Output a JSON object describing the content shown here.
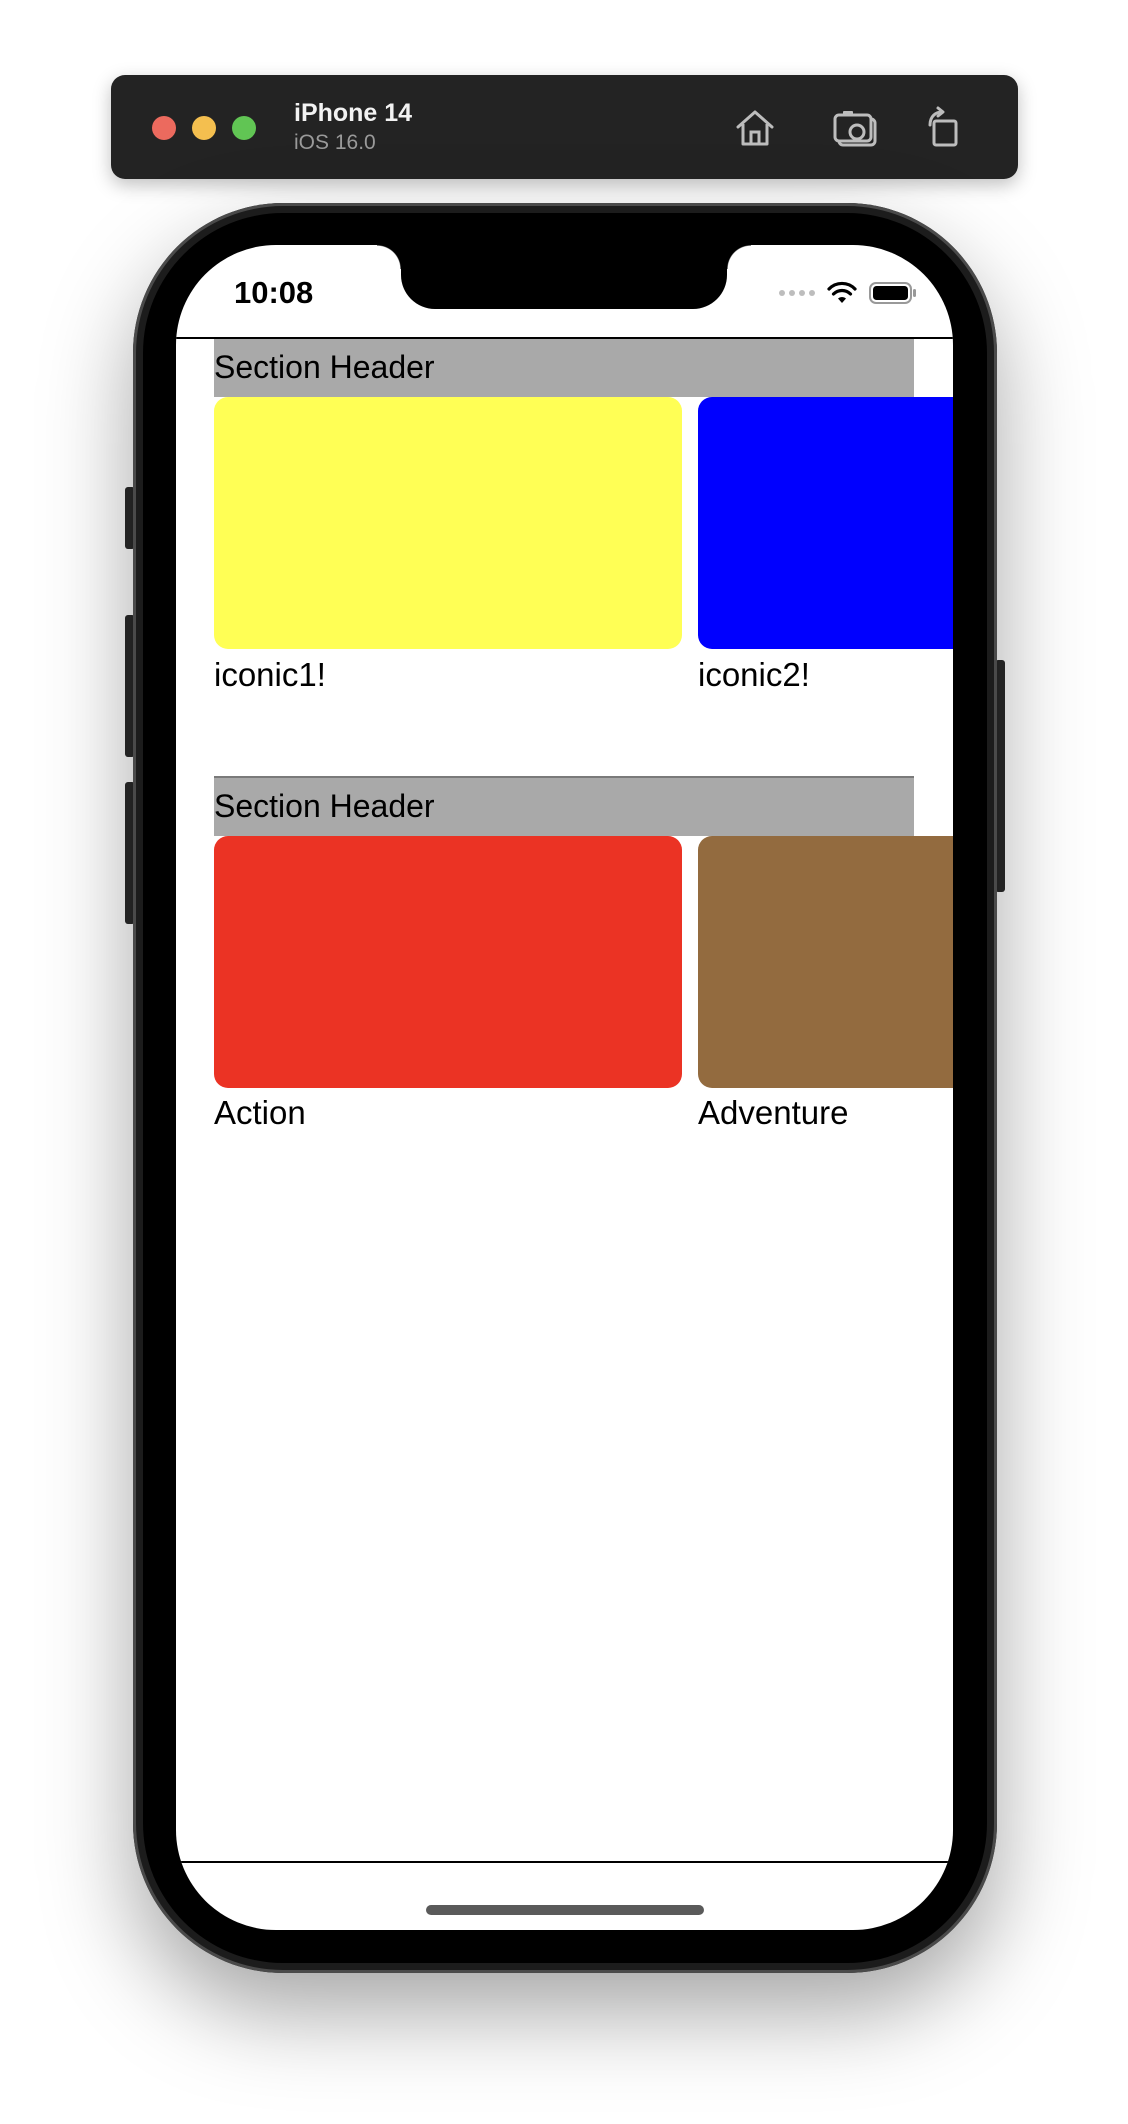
{
  "simulator": {
    "device_name": "iPhone 14",
    "os_version": "iOS 16.0",
    "icons": [
      "home-icon",
      "screenshot-icon",
      "rotate-icon"
    ]
  },
  "status_bar": {
    "time": "10:08",
    "icons": [
      "cellular-icon",
      "wifi-icon",
      "battery-icon"
    ]
  },
  "sections": [
    {
      "header": "Section Header",
      "items": [
        {
          "label": "iconic1!",
          "color": "#FFFF55"
        },
        {
          "label": "iconic2!",
          "color": "#0000FF"
        }
      ]
    },
    {
      "header": "Section Header",
      "items": [
        {
          "label": "Action",
          "color": "#EB3324"
        },
        {
          "label": "Adventure",
          "color": "#936B3F"
        }
      ]
    }
  ]
}
